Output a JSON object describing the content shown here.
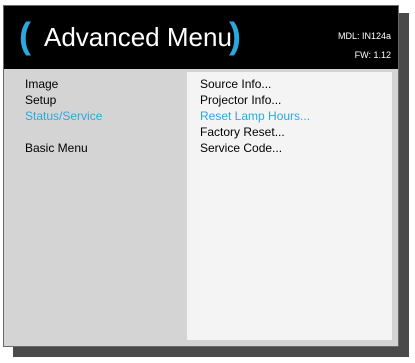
{
  "header": {
    "title": "Advanced Menu",
    "paren_left": "(",
    "paren_right": ")",
    "model": "MDL: IN124a",
    "firmware": "FW: 1.12"
  },
  "left_menu": {
    "items": [
      {
        "label": "Image",
        "active": false
      },
      {
        "label": "Setup",
        "active": false
      },
      {
        "label": "Status/Service",
        "active": true
      },
      {
        "label": "Basic Menu",
        "active": false
      }
    ]
  },
  "right_menu": {
    "items": [
      {
        "label": "Source Info...",
        "active": false
      },
      {
        "label": "Projector Info...",
        "active": false
      },
      {
        "label": "Reset Lamp Hours...",
        "active": true
      },
      {
        "label": "Factory Reset...",
        "active": false
      },
      {
        "label": "Service Code...",
        "active": false
      }
    ]
  },
  "colors": {
    "accent": "#29a9e0",
    "header_bg": "#000000",
    "panel_bg": "#d4d4d4",
    "submenu_bg": "#f4f4f4",
    "shadow": "#4a4a4a"
  }
}
